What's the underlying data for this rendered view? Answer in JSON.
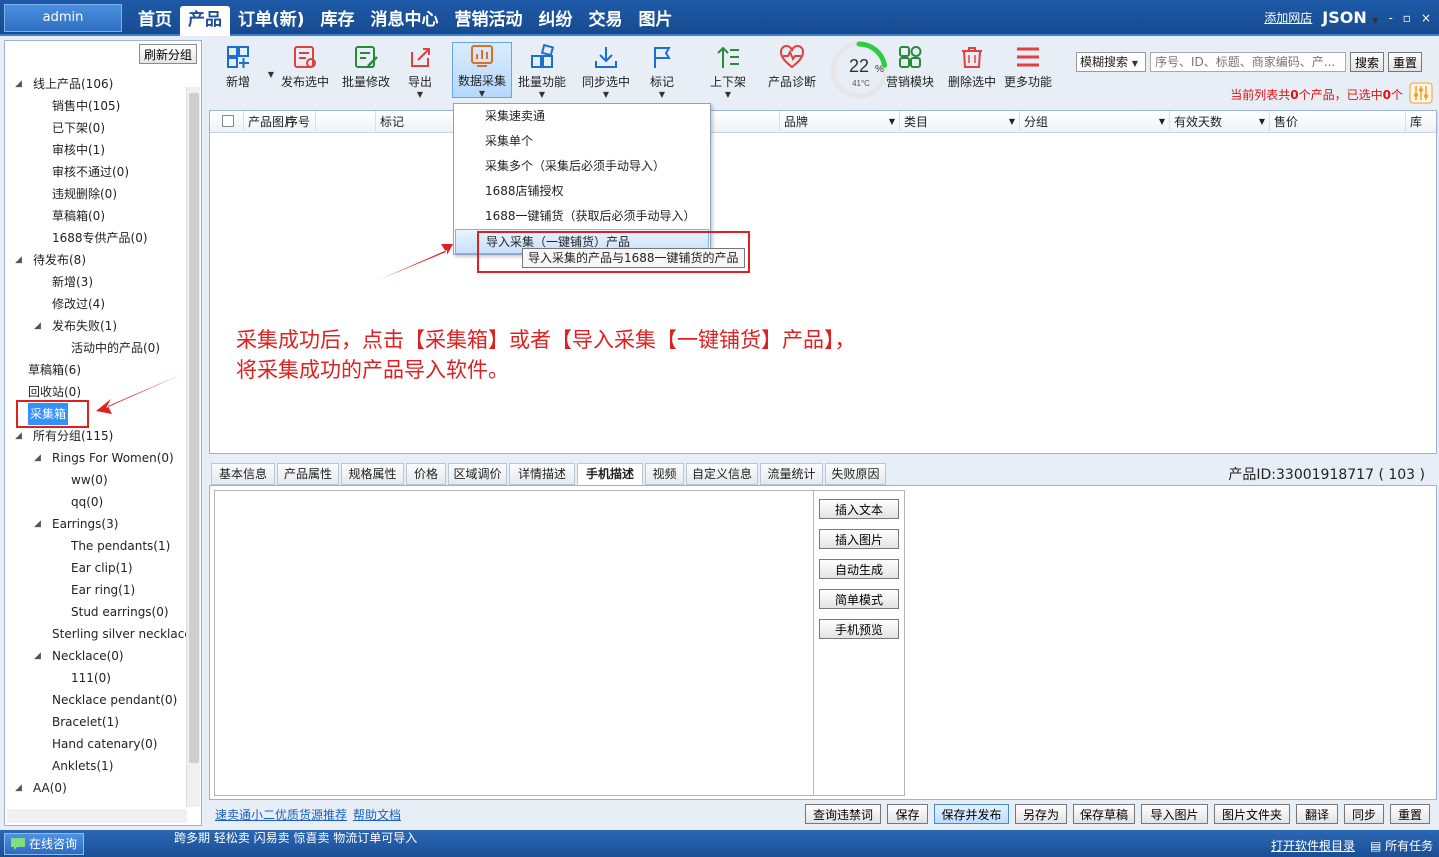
{
  "app": {
    "user": "admin",
    "nav": [
      "首页",
      "产品",
      "订单(新)",
      "库存",
      "消息中心",
      "营销活动",
      "纠纷",
      "交易",
      "图片"
    ],
    "active_nav": "产品",
    "add_shop": "添加网店",
    "account_menu": "JSON",
    "window_controls": [
      "-",
      "▫",
      "×"
    ]
  },
  "sidebar": {
    "refresh_label": "刷新分组",
    "tree": [
      {
        "label": "线上产品(106)",
        "level": 0,
        "expanded": true
      },
      {
        "label": "销售中(105)",
        "level": 1
      },
      {
        "label": "已下架(0)",
        "level": 1
      },
      {
        "label": "审核中(1)",
        "level": 1
      },
      {
        "label": "审核不通过(0)",
        "level": 1
      },
      {
        "label": "违规删除(0)",
        "level": 1
      },
      {
        "label": "草稿箱(0)",
        "level": 1
      },
      {
        "label": "1688专供产品(0)",
        "level": 1
      },
      {
        "label": "待发布(8)",
        "level": 0,
        "expanded": true
      },
      {
        "label": "新增(3)",
        "level": 1
      },
      {
        "label": "修改过(4)",
        "level": 1
      },
      {
        "label": "发布失败(1)",
        "level": 1,
        "expanded": true
      },
      {
        "label": "活动中的产品(0)",
        "level": 2
      },
      {
        "label": "草稿箱(6)",
        "level": 0,
        "leaf": true
      },
      {
        "label": "回收站(0)",
        "level": 0,
        "leaf": true
      },
      {
        "label": "采集箱",
        "level": 0,
        "leaf": true,
        "selected": true
      },
      {
        "label": "所有分组(115)",
        "level": 0,
        "expanded": true
      },
      {
        "label": "Rings For Women(0)",
        "level": 1,
        "expanded": true
      },
      {
        "label": "ww(0)",
        "level": 2
      },
      {
        "label": "qq(0)",
        "level": 2
      },
      {
        "label": "Earrings(3)",
        "level": 1,
        "expanded": true
      },
      {
        "label": "The pendants(1)",
        "level": 2
      },
      {
        "label": "Ear clip(1)",
        "level": 2
      },
      {
        "label": "Ear ring(1)",
        "level": 2
      },
      {
        "label": "Stud earrings(0)",
        "level": 2
      },
      {
        "label": "Sterling silver necklace(",
        "level": 1
      },
      {
        "label": "Necklace(0)",
        "level": 1,
        "expanded": true
      },
      {
        "label": "111(0)",
        "level": 2
      },
      {
        "label": "Necklace pendant(0)",
        "level": 1
      },
      {
        "label": "Bracelet(1)",
        "level": 1
      },
      {
        "label": "Hand catenary(0)",
        "level": 1
      },
      {
        "label": "Anklets(1)",
        "level": 1
      },
      {
        "label": "AA(0)",
        "level": 0,
        "expanded": true
      }
    ]
  },
  "toolbar": {
    "tools": [
      {
        "label": "新增",
        "icon": "add-grid-icon",
        "caret": true
      },
      {
        "label": "发布选中",
        "icon": "publish-icon"
      },
      {
        "label": "批量修改",
        "icon": "batch-edit-icon"
      },
      {
        "label": "导出",
        "icon": "export-icon",
        "caret": true
      },
      {
        "label": "数据采集",
        "icon": "data-collect-icon",
        "caret": true,
        "active": true
      },
      {
        "label": "批量功能",
        "icon": "batch-function-icon",
        "caret": true
      },
      {
        "label": "同步选中",
        "icon": "sync-icon",
        "caret": true
      },
      {
        "label": "标记",
        "icon": "flag-icon",
        "caret": true
      },
      {
        "label": "上下架",
        "icon": "shelf-icon",
        "caret": true
      },
      {
        "label": "产品诊断",
        "icon": "diagnosis-icon"
      },
      {
        "label": "营销模块",
        "icon": "marketing-icon"
      },
      {
        "label": "删除选中",
        "icon": "trash-icon"
      },
      {
        "label": "更多功能",
        "icon": "menu-icon"
      }
    ],
    "gauge": {
      "percent": "22",
      "unit": "%",
      "temp": "41°C",
      "level": 0.22
    },
    "search_mode": "模糊搜索",
    "search_placeholder": "序号、ID、标题、商家编码、产...",
    "search_btn": "搜索",
    "reset_btn": "重置",
    "status_prefix": "当前列表共",
    "status_count": "0",
    "status_mid": "个产品，已选中",
    "status_selected": "0",
    "status_suffix": "个"
  },
  "grid": {
    "columns": [
      "产品图片",
      "序号",
      "标记",
      "品牌",
      "类目",
      "分组",
      "有效天数",
      "售价",
      "库"
    ]
  },
  "dropdown": {
    "items": [
      "采集速卖通",
      "采集单个",
      "采集多个（采集后必须手动导入）",
      "1688店铺授权",
      "1688一键铺货（获取后必须手动导入）",
      "导入采集（一键铺货）产品"
    ],
    "tooltip": "导入采集的产品与1688一键铺货的产品"
  },
  "annotation": {
    "line1": "采集成功后，点击【采集箱】或者【导入采集【一键铺货】产品】，",
    "line2": "将采集成功的产品导入软件。"
  },
  "detail": {
    "tabs": [
      "基本信息",
      "产品属性",
      "规格属性",
      "价格",
      "区域调价",
      "详情描述",
      "手机描述",
      "视频",
      "自定义信息",
      "流量统计",
      "失败原因"
    ],
    "active_tab": "手机描述",
    "product_id": "产品ID:33001918717 ( 103 )",
    "editor_buttons": [
      "插入文本",
      "插入图片",
      "自动生成",
      "简单模式",
      "手机预览"
    ]
  },
  "bottom": {
    "links": [
      "速卖通小二优质货源推荐",
      "帮助文档"
    ],
    "buttons": [
      "查询违禁词",
      "保存",
      "保存并发布",
      "另存为",
      "保存草稿",
      "导入图片",
      "图片文件夹",
      "翻译",
      "同步",
      "重置"
    ]
  },
  "statusbar": {
    "online": "在线咨询",
    "ticker": "跨多期 轻松卖 闪易卖 惊喜卖 物流订单可导入",
    "open_dir": "打开软件根目录",
    "all_tasks": "所有任务"
  },
  "colors": {
    "accent": "#1e5aa8",
    "highlight": "#e02020",
    "selected": "#3390ff",
    "status_red": "#e01010"
  }
}
